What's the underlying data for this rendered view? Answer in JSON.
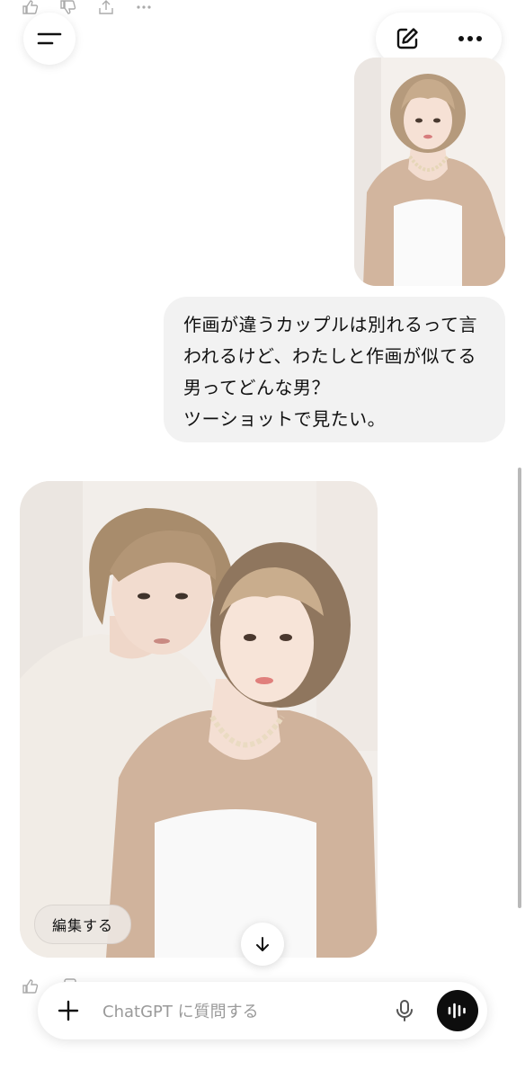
{
  "header": {
    "menu_icon": "menu-icon",
    "new_chat_icon": "edit-icon",
    "more_icon": "more-icon"
  },
  "conversation": {
    "user_message": {
      "lines": [
        "作画が違うカップルは別れるって言",
        "われるけど、わたしと作画が似てる",
        "男ってどんな男？",
        "ツーショットで見たい。"
      ]
    },
    "assistant": {
      "edit_label": "編集する"
    }
  },
  "composer": {
    "placeholder": "ChatGPT に質問する"
  },
  "colors": {
    "bubble": "#f2f2f2",
    "voice_button": "#0d0d0d"
  }
}
